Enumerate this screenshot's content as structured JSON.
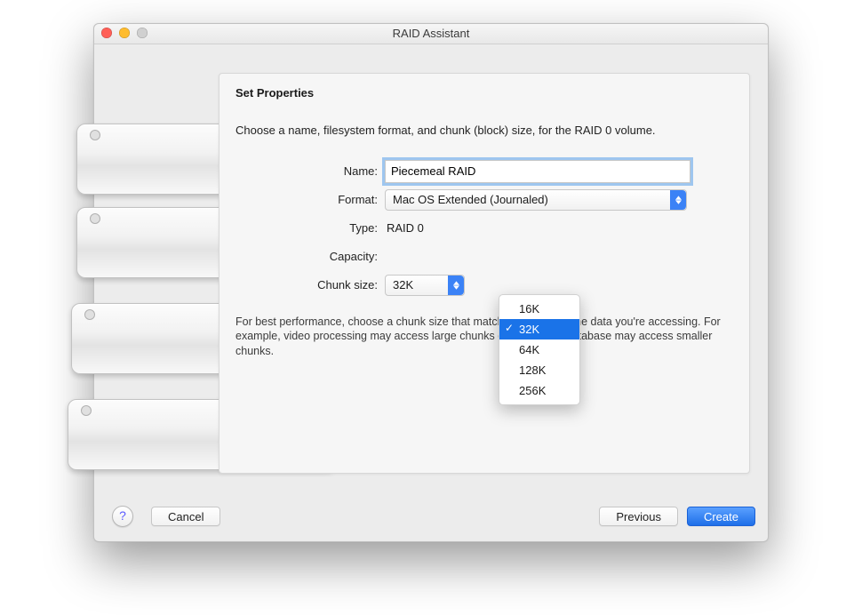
{
  "window": {
    "title": "RAID Assistant"
  },
  "sheet": {
    "heading": "Set Properties",
    "intro": "Choose a name, filesystem format, and chunk (block) size, for the RAID 0 volume.",
    "hint": "For best performance, choose a chunk size that matches the size of the data you're accessing. For example, video processing may access large chunks of data, but a database may access smaller chunks."
  },
  "form": {
    "name_label": "Name:",
    "name_value": "Piecemeal RAID",
    "format_label": "Format:",
    "format_value": "Mac OS Extended (Journaled)",
    "type_label": "Type:",
    "type_value": "RAID 0",
    "capacity_label": "Capacity:",
    "chunk_label": "Chunk size:"
  },
  "chunk_menu": {
    "options": [
      "16K",
      "32K",
      "64K",
      "128K",
      "256K"
    ],
    "selected": "32K"
  },
  "buttons": {
    "help": "?",
    "cancel": "Cancel",
    "previous": "Previous",
    "create": "Create"
  }
}
